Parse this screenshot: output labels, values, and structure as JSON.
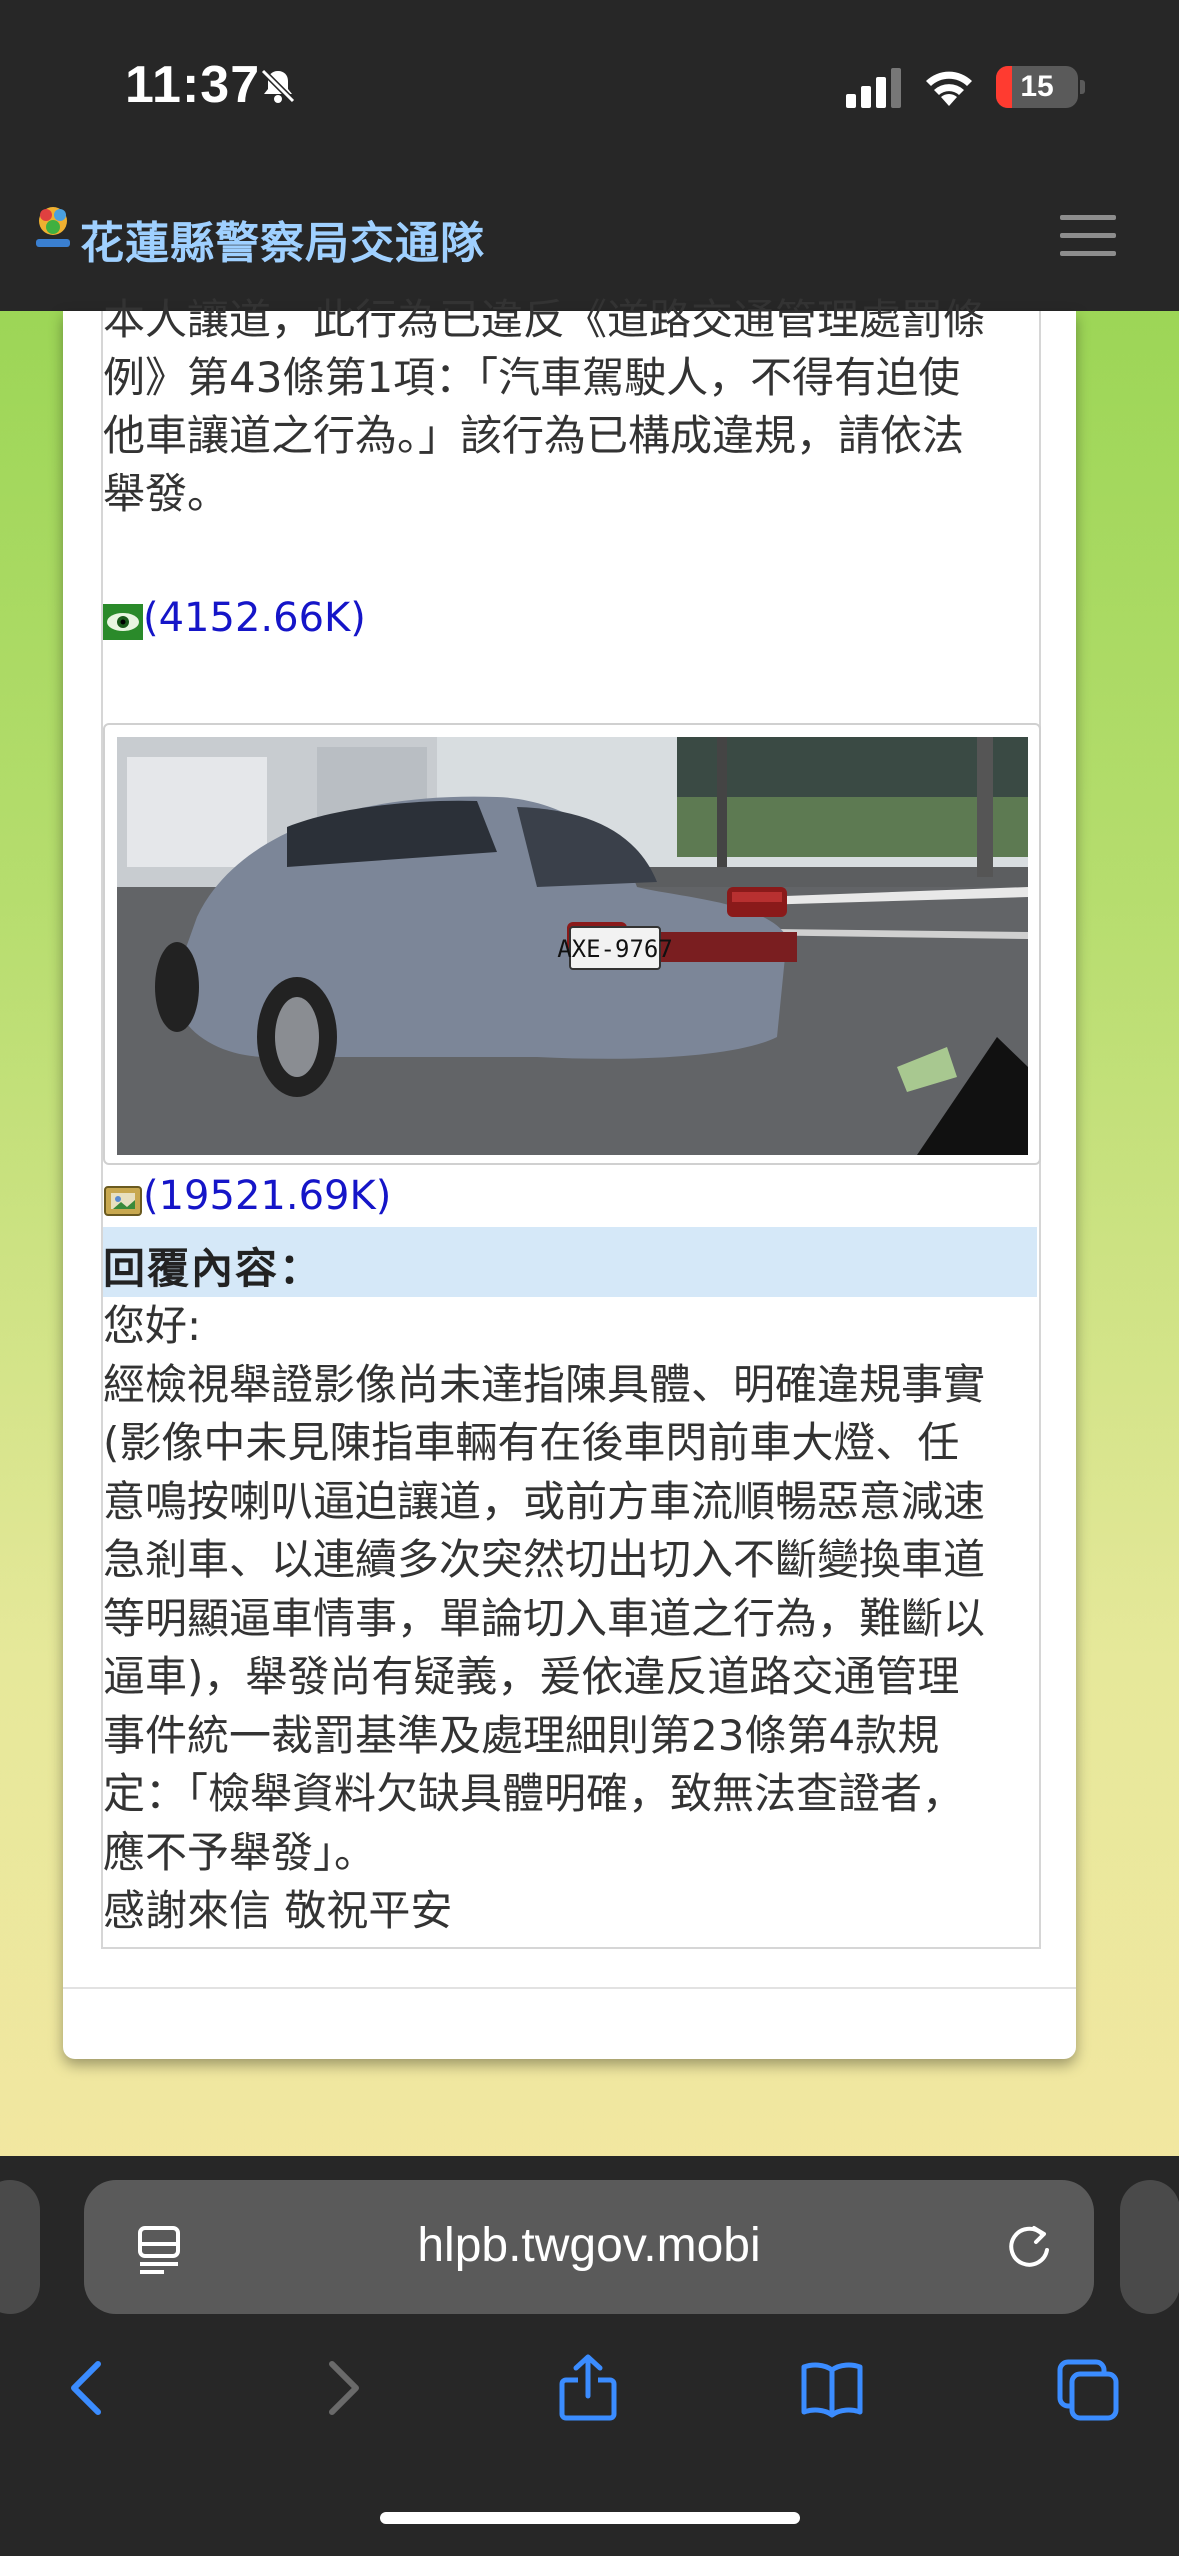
{
  "status_bar": {
    "time": "11:37",
    "battery": "15"
  },
  "header": {
    "site_title": "花蓮縣警察局交通隊"
  },
  "report": {
    "lines": [
      "本人讓道，此行為已違反《道路交通管理處罰條",
      "例》第43條第1項：「汽車駕駛人，不得有迫使",
      "他車讓道之行為。」該行為已構成違規，請依法",
      "舉發。"
    ],
    "video_link": "(4152.66K)",
    "photo_link": "(19521.69K)",
    "photo_plate": "AXE-9767"
  },
  "reply": {
    "heading": "回覆內容：",
    "lines": [
      "您好:",
      "經檢視舉證影像尚未達指陳具體、明確違規事實",
      "(影像中未見陳指車輛有在後車閃前車大燈、任",
      "意鳴按喇叭逼迫讓道，或前方車流順暢惡意減速",
      "急剎車、以連續多次突然切出切入不斷變換車道",
      "等明顯逼車情事，單論切入車道之行為，難斷以",
      "逼車)，舉發尚有疑義，爰依違反道路交通管理",
      "事件統一裁罰基準及處理細則第23條第4款規",
      "定：「檢舉資料欠缺具體明確，致無法查證者，",
      "應不予舉發」。",
      "感謝來信 敬祝平安"
    ]
  },
  "browser": {
    "url": "hlpb.twgov.mobi"
  }
}
